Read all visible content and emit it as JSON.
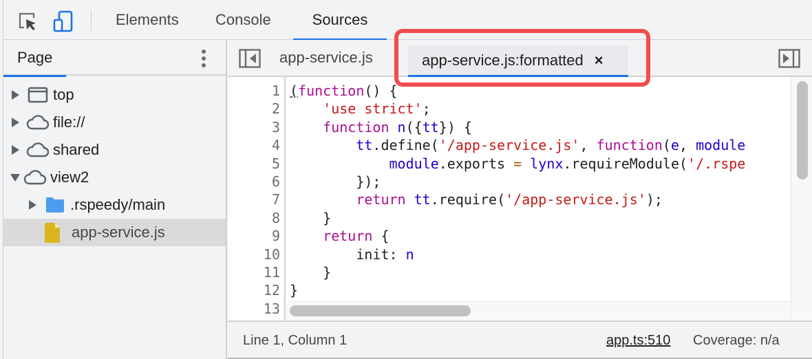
{
  "toolbar": {
    "inspect_icon": "inspect-element-icon",
    "device_icon": "device-toolbar-icon",
    "tabs": [
      {
        "label": "Elements",
        "active": false
      },
      {
        "label": "Console",
        "active": false
      },
      {
        "label": "Sources",
        "active": true
      }
    ]
  },
  "navigator": {
    "tab_label": "Page",
    "more_icon": "kebab-menu-icon",
    "tree": [
      {
        "label": "top",
        "icon": "frame-icon",
        "expanded": false,
        "depth": 0
      },
      {
        "label": "file://",
        "icon": "cloud-icon",
        "expanded": false,
        "depth": 0
      },
      {
        "label": "shared",
        "icon": "cloud-icon",
        "expanded": false,
        "depth": 0
      },
      {
        "label": "view2",
        "icon": "cloud-icon",
        "expanded": true,
        "depth": 0
      },
      {
        "label": ".rspeedy/main",
        "icon": "folder-icon",
        "expanded": false,
        "depth": 1
      },
      {
        "label": "app-service.js",
        "icon": "file-icon",
        "selected": true,
        "depth": 1
      }
    ]
  },
  "editor": {
    "tabs": [
      {
        "label": "app-service.js",
        "active": false
      },
      {
        "label": "app-service.js:formatted",
        "active": true,
        "closable": true,
        "close_glyph": "×"
      }
    ],
    "line_numbers": [
      "1",
      "2",
      "3",
      "4",
      "5",
      "6",
      "7",
      "8",
      "9",
      "10",
      "11",
      "12",
      "13"
    ],
    "code_lines": [
      "(function() {",
      "    'use strict';",
      "    function n({tt}) {",
      "        tt.define('/app-service.js', function(e, module",
      "            module.exports = lynx.requireModule('/.rspe",
      "        });",
      "        return tt.require('/app-service.js');",
      "    }",
      "    return {",
      "        init: n",
      "    }",
      "}",
      ""
    ]
  },
  "status": {
    "position": "Line 1, Column 1",
    "source_link": "app.ts:510",
    "coverage": "Coverage: n/a"
  },
  "colors": {
    "accent": "#1a73e8",
    "highlight_box": "#f24c4c",
    "keyword": "#aa0d91",
    "string": "#c41a16",
    "variable": "#1c00cf",
    "folder": "#4c9cf0",
    "file": "#dab520"
  }
}
